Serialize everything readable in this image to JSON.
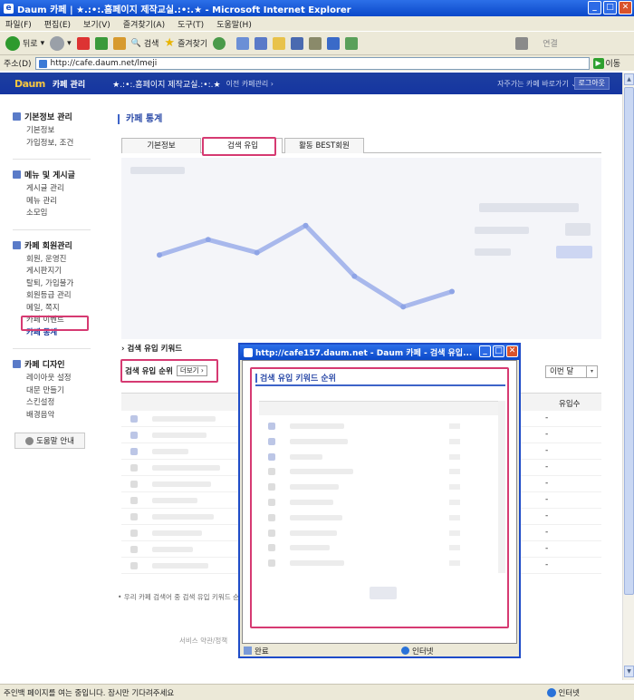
{
  "window": {
    "title": "Daum 카페 | ★.:•:.홈페이지 제작교실.:•:.★ - Microsoft Internet Explorer"
  },
  "menu": [
    "파일(F)",
    "편집(E)",
    "보기(V)",
    "즐겨찾기(A)",
    "도구(T)",
    "도움말(H)"
  ],
  "toolbar": {
    "back": "뒤로",
    "search": "검색",
    "favorites": "즐겨찾기",
    "connect": "연결"
  },
  "address": {
    "label": "주소(D)",
    "url": "http://cafe.daum.net/lmeji",
    "go": "이동"
  },
  "daum": {
    "logo": "Daum",
    "mgmt": "카페 관리",
    "cafe_name": "★.:•:.홈페이지 제작교실.:•:.★",
    "prev_mgmt": "이전 카페관리 ›",
    "quick": "자주가는 카페 바로가기 ⌄",
    "logout": "로그아웃"
  },
  "sidebar": {
    "sections": [
      {
        "title": "기본정보 관리",
        "items": [
          "기본정보",
          "가입정보, 조건"
        ]
      },
      {
        "title": "메뉴 및 게시글",
        "items": [
          "게시글 관리",
          "메뉴 관리",
          "소모임"
        ]
      },
      {
        "title": "카페 회원관리",
        "items": [
          "회원, 운영진",
          "게시판지기",
          "탈퇴, 가입불가",
          "회원등급 관리",
          "메일, 쪽지",
          "카페 이벤트",
          "카페 통계"
        ]
      },
      {
        "title": "카페 디자인",
        "items": [
          "레이아웃 설정",
          "대문 만들기",
          "스킨설정",
          "배경음악"
        ]
      }
    ],
    "help": "도움말 안내"
  },
  "main": {
    "title": "카페 통계",
    "tabs": [
      "기본정보",
      "검색 유입",
      "활동 BEST회원"
    ],
    "kw_head": "› 검색 유입 키워드",
    "kw_rank": "검색 유입 순위",
    "more": "더보기 ›",
    "period": "이번 달",
    "col_inflow": "유입수",
    "rows_dash": [
      "-",
      "-",
      "-",
      "-",
      "-",
      "-",
      "-",
      "-",
      "-",
      "-"
    ],
    "note": "• 우리 카페 검색어 중 검색 유입 키워드 순위",
    "footer": "서비스 약관/정책"
  },
  "popup": {
    "title": "http://cafe157.daum.net - Daum 카페 - 검색 유입...",
    "heading": "검색 유입 키워드 순위",
    "status": "완료",
    "zone": "인터넷"
  },
  "status": {
    "text": "주인백 페이지를 여는 중입니다. 잠시만 기다려주세요",
    "zone": "인터넷"
  },
  "chart_data": {
    "type": "line",
    "values": [
      0.56,
      0.69,
      0.58,
      0.81,
      0.38,
      0.12,
      0.25
    ]
  }
}
